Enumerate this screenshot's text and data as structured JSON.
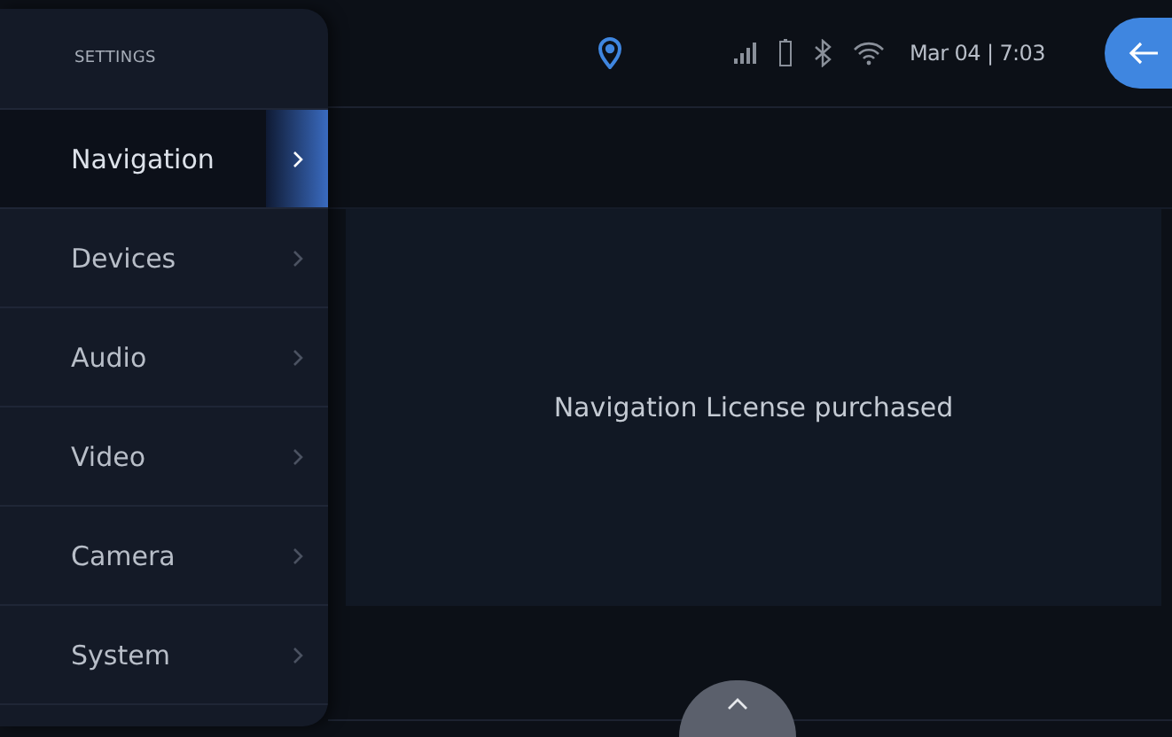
{
  "sidebar": {
    "title": "SETTINGS",
    "items": [
      {
        "label": "Navigation",
        "selected": true
      },
      {
        "label": "Devices",
        "selected": false
      },
      {
        "label": "Audio",
        "selected": false
      },
      {
        "label": "Video",
        "selected": false
      },
      {
        "label": "Camera",
        "selected": false
      },
      {
        "label": "System",
        "selected": false
      }
    ]
  },
  "status_bar": {
    "datetime": "Mar 04 | 7:03"
  },
  "content": {
    "message": "Navigation License purchased"
  }
}
